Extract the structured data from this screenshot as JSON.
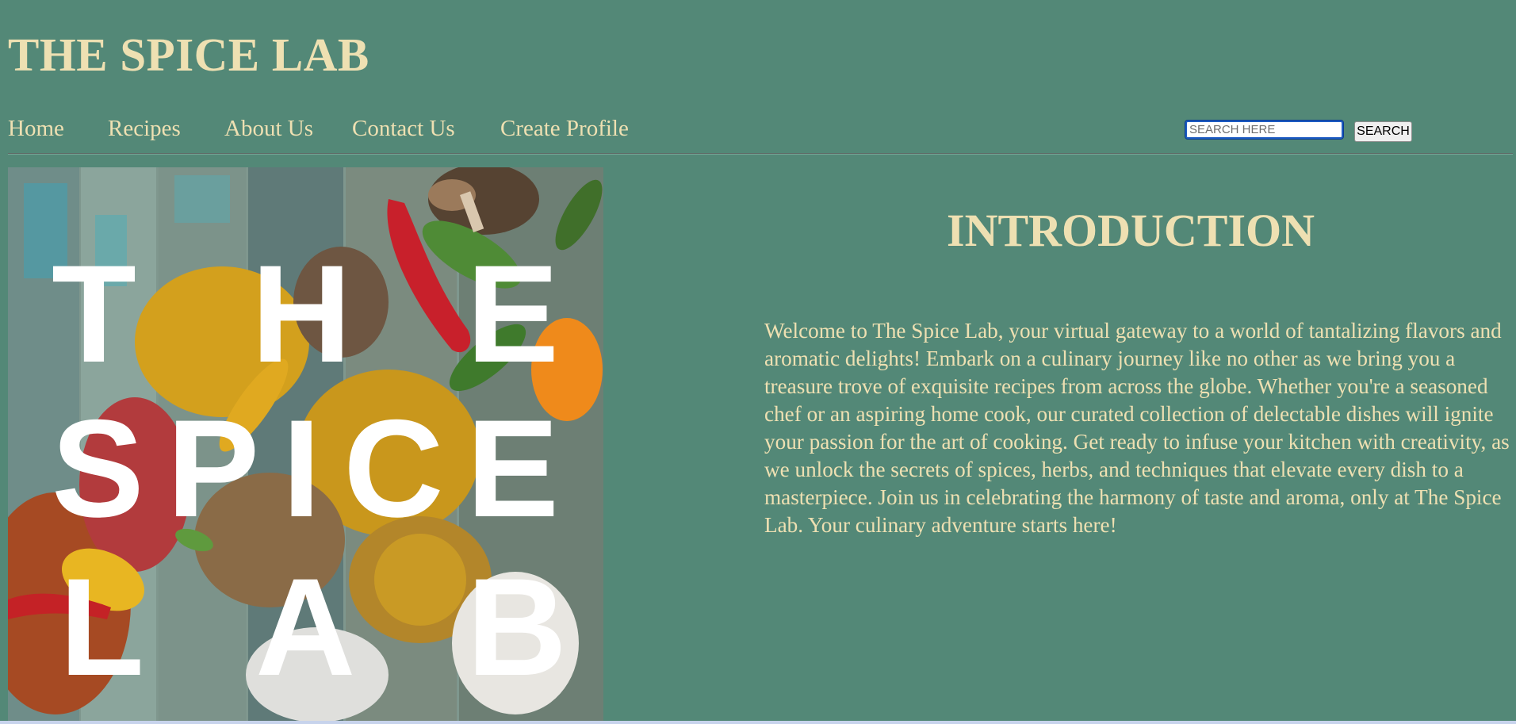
{
  "site": {
    "title": "THE SPICE LAB"
  },
  "nav": {
    "items": [
      {
        "label": "Home"
      },
      {
        "label": "Recipes"
      },
      {
        "label": "About Us"
      },
      {
        "label": "Contact Us"
      },
      {
        "label": "Create Profile"
      }
    ]
  },
  "search": {
    "placeholder": "SEARCH HERE",
    "value": "",
    "button_label": "SEARCH"
  },
  "hero": {
    "image_text_line1": "THE",
    "image_text_line2": "SPICE",
    "image_text_line3": "LAB"
  },
  "intro": {
    "heading": "INTRODUCTION",
    "body": "Welcome to The Spice Lab, your virtual gateway to a world of tantalizing flavors and aromatic delights! Embark on a culinary journey like no other as we bring you a treasure trove of exquisite recipes from across the globe. Whether you're a seasoned chef or an aspiring home cook, our curated collection of delectable dishes will ignite your passion for the art of cooking. Get ready to infuse your kitchen with creativity, as we unlock the secrets of spices, herbs, and techniques that elevate every dish to a masterpiece. Join us in celebrating the harmony of taste and aroma, only at The Spice Lab. Your culinary adventure starts here!"
  },
  "colors": {
    "background": "#538877",
    "text": "#eee0b2",
    "search_border": "#1d5bc2"
  }
}
